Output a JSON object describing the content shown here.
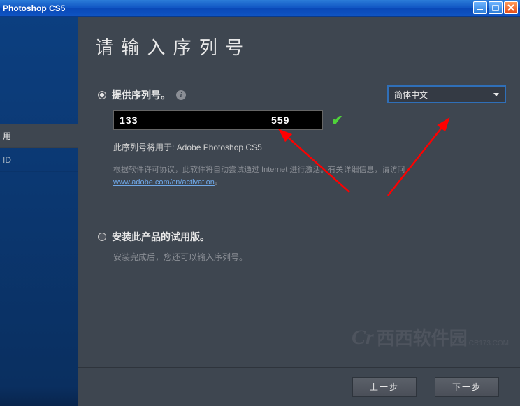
{
  "titlebar": {
    "title": "Photoshop CS5"
  },
  "sidebar": {
    "items": [
      {
        "label": "用"
      },
      {
        "label": "ID"
      }
    ]
  },
  "main": {
    "heading": "请 输 入 序 列 号"
  },
  "section_serial": {
    "title": "提供序列号。",
    "info_glyph": "i",
    "serial_display": "133                                       559",
    "checkmark": "✔",
    "usage_note": "此序列号将用于: Adobe Photoshop CS5",
    "legal_note_prefix": "根据软件许可协议，此软件将自动尝试通过 Internet 进行激活。有关详细信息，请访问",
    "legal_link_text": "www.adobe.com/cn/activation",
    "legal_note_suffix": "。"
  },
  "lang_select": {
    "selected": "简体中文"
  },
  "section_trial": {
    "title": "安装此产品的试用版。",
    "sub_note": "安装完成后，您还可以输入序列号。"
  },
  "watermark": {
    "cr": "Cr",
    "text": "西西软件园",
    "sub": "CR173.COM"
  },
  "footer": {
    "prev": "上一步",
    "next": "下一步"
  },
  "icons": {
    "minimize": "minimize-icon",
    "maximize": "maximize-icon",
    "close": "close-icon",
    "chevron_down": "chevron-down-icon"
  },
  "accent_colors": {
    "titlebar_blue": "#0f54c3",
    "main_bg": "#3e4650",
    "check_green": "#4fd23a",
    "link_blue": "#6fa8e8",
    "select_border": "#2f6fb8",
    "arrow_red": "#ff0000"
  }
}
